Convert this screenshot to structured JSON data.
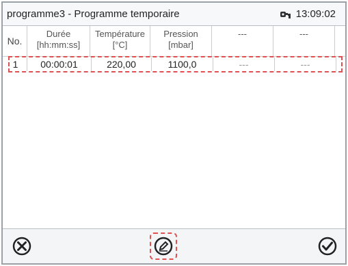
{
  "header": {
    "title": "programme3 - Programme temporaire",
    "time": "13:09:02"
  },
  "table": {
    "columns": [
      {
        "line1": "No.",
        "line2": ""
      },
      {
        "line1": "Durée",
        "line2": "[hh:mm:ss]"
      },
      {
        "line1": "Température",
        "line2": "[°C]"
      },
      {
        "line1": "Pression",
        "line2": "[mbar]"
      },
      {
        "line1": "---",
        "line2": ""
      },
      {
        "line1": "---",
        "line2": ""
      }
    ],
    "rows": [
      {
        "no": "1",
        "duree": "00:00:01",
        "temperature": "220,00",
        "pression": "1100,0",
        "c5": "---",
        "c6": "---"
      }
    ]
  },
  "footer": {
    "cancel_icon": "cancel-icon",
    "edit_icon": "edit-icon",
    "confirm_icon": "confirm-icon"
  },
  "colors": {
    "highlight": "#e05050"
  }
}
